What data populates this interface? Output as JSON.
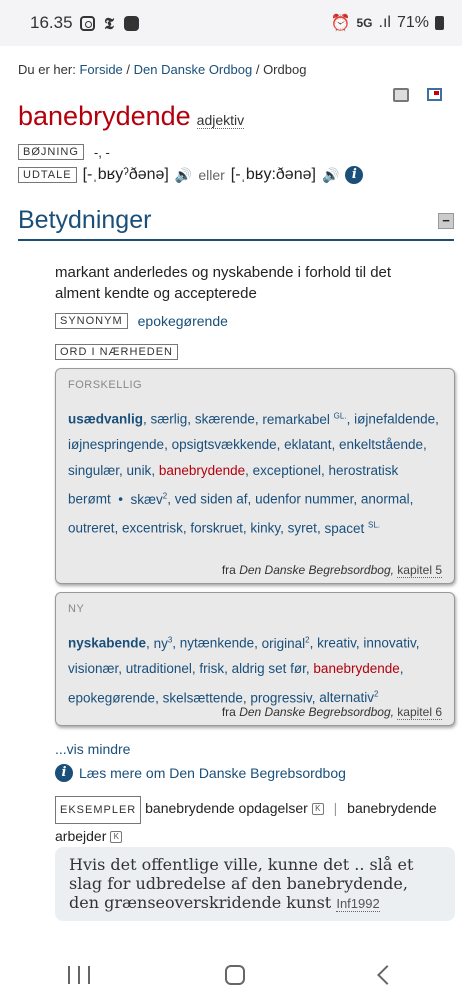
{
  "status_bar": {
    "time": "16.35",
    "network": "5G",
    "signal": ".ıl",
    "battery": "71%"
  },
  "breadcrumb": {
    "prefix": "Du er her:",
    "items": [
      "Forside",
      "Den Danske Ordbog",
      "Ordbog"
    ],
    "separator": "/"
  },
  "entry": {
    "headword": "banebrydende",
    "pos": "adjektiv",
    "boejning_tag": "BØJNING",
    "boejning_value": "-, -",
    "udtale_tag": "UDTALE",
    "pron1": "[-ˌbʁyˀðənə]",
    "eller": "eller",
    "pron2": "[-ˌbʁy:ðənə]"
  },
  "section": {
    "title": "Betydninger",
    "collapse_label": "−"
  },
  "definition": "markant anderledes og nyskabende i forhold til det alment kendte og accepterede",
  "synonym": {
    "tag": "SYNONYM",
    "value": "epokegørende"
  },
  "nearby_tag": "ORD I NÆRHEDEN",
  "boxes": [
    {
      "category": "FORSKELLIG",
      "source_prefix": "fra",
      "source_book": "Den Danske Begrebsordbog,",
      "source_chapter": "kapitel 5"
    },
    {
      "category": "NY",
      "source_prefix": "fra",
      "source_book": "Den Danske Begrebsordbog,",
      "source_chapter": "kapitel 6"
    }
  ],
  "vis_mindre": "...vis mindre",
  "laes_mere": "Læs mere om Den Danske Begrebsordbog",
  "examples": {
    "tag": "EKSEMPLER",
    "items": [
      "banebrydende opdagelser",
      "banebrydende arbejder"
    ]
  },
  "quote": {
    "text": "Hvis det offentlige ville, kunne det .. slå et slag for udbredelse af den banebrydende, den grænseoverskridende kunst",
    "source": "Inf1992"
  }
}
